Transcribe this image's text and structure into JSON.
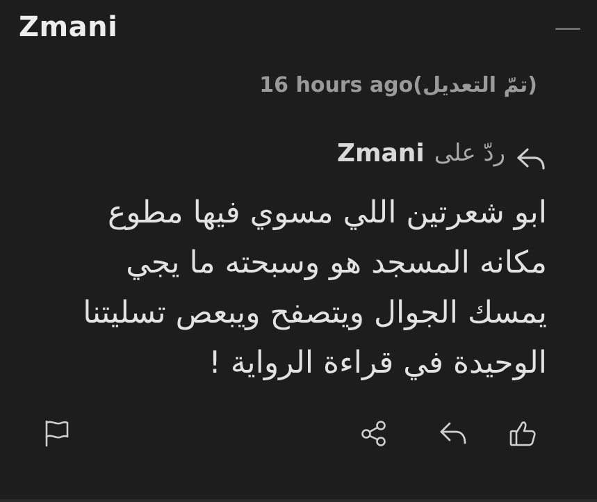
{
  "comment": {
    "author": "Zmani",
    "timestamp": "16 hours ago(تمّ التعديل)",
    "reply_prefix": "ردّ على",
    "reply_to": "Zmani",
    "body_lines": [
      "ابو شعرتين اللي مسوي فيها مطوع",
      "مكانه المسجد هو وسبحته ما يجي",
      "يمسك الجوال ويتصفح ويبعص تسليتنا",
      "الوحيدة في قراءة الرواية !"
    ]
  },
  "icons": {
    "collapse": "minus-icon",
    "reply_to": "reply-arrow-icon",
    "flag": "flag-icon",
    "share": "share-icon",
    "reply": "reply-icon",
    "like": "thumbs-up-icon"
  },
  "colors": {
    "background": "#1d1d1d",
    "text": "#e2e2e2",
    "muted": "#9a9a9a"
  }
}
